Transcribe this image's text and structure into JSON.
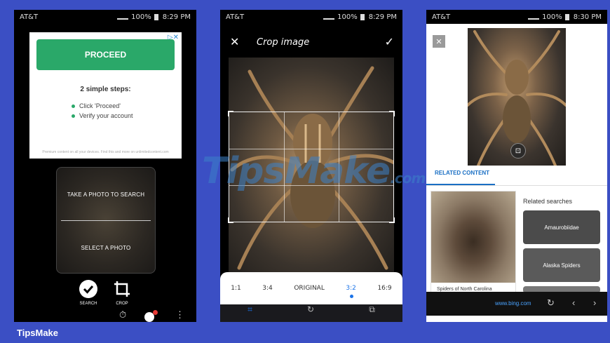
{
  "screen1": {
    "status": {
      "carrier": "AT&T",
      "battery": "100%",
      "time": "8:29 PM"
    },
    "ad": {
      "button_label": "PROCEED",
      "steps_title": "2 simple steps:",
      "steps": [
        "Click 'Proceed'",
        "Verify your account"
      ],
      "fine_print": "Premium content on all your devices. Find this and more on unlimitedcontent.com"
    },
    "search_options": [
      "TAKE A PHOTO TO SEARCH",
      "SELECT A PHOTO"
    ],
    "tools": [
      {
        "label": "SEARCH",
        "icon": "check-circle-icon"
      },
      {
        "label": "CROP",
        "icon": "crop-icon"
      }
    ]
  },
  "screen2": {
    "status": {
      "carrier": "AT&T",
      "battery": "100%",
      "time": "8:29 PM"
    },
    "title": "Crop image",
    "ratios": [
      "1:1",
      "3:4",
      "ORIGINAL",
      "3:2",
      "16:9"
    ],
    "selected_ratio": "3:2"
  },
  "screen3": {
    "status": {
      "carrier": "AT&T",
      "battery": "100%",
      "time": "8:30 PM"
    },
    "related_tab": "RELATED CONTENT",
    "card_caption": "Spiders of North Carolina",
    "related_searches_title": "Related searches",
    "related_searches": [
      "Amaurobiidae",
      "Alaska Spiders"
    ],
    "url": "www.bing.com"
  },
  "watermark": {
    "main": "TipsMake",
    "suffix": ".com"
  },
  "footer": {
    "brand": "TipsMake"
  },
  "colors": {
    "background": "#3b4fc4",
    "proceed_green": "#2aa869",
    "accent_blue": "#1a73e8"
  }
}
